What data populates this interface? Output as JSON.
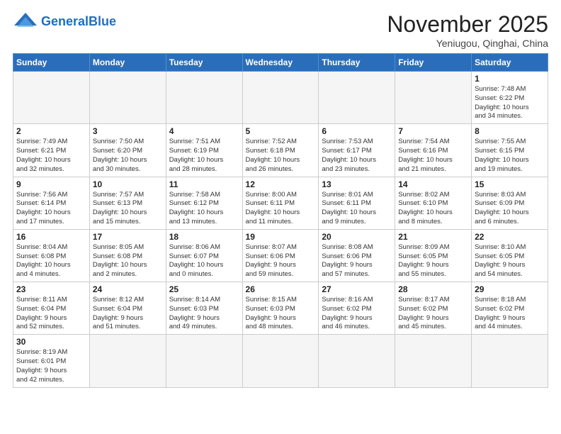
{
  "header": {
    "logo_general": "General",
    "logo_blue": "Blue",
    "month_title": "November 2025",
    "location": "Yeniugou, Qinghai, China"
  },
  "weekdays": [
    "Sunday",
    "Monday",
    "Tuesday",
    "Wednesday",
    "Thursday",
    "Friday",
    "Saturday"
  ],
  "weeks": [
    [
      {
        "day": "",
        "info": ""
      },
      {
        "day": "",
        "info": ""
      },
      {
        "day": "",
        "info": ""
      },
      {
        "day": "",
        "info": ""
      },
      {
        "day": "",
        "info": ""
      },
      {
        "day": "",
        "info": ""
      },
      {
        "day": "1",
        "info": "Sunrise: 7:48 AM\nSunset: 6:22 PM\nDaylight: 10 hours\nand 34 minutes."
      }
    ],
    [
      {
        "day": "2",
        "info": "Sunrise: 7:49 AM\nSunset: 6:21 PM\nDaylight: 10 hours\nand 32 minutes."
      },
      {
        "day": "3",
        "info": "Sunrise: 7:50 AM\nSunset: 6:20 PM\nDaylight: 10 hours\nand 30 minutes."
      },
      {
        "day": "4",
        "info": "Sunrise: 7:51 AM\nSunset: 6:19 PM\nDaylight: 10 hours\nand 28 minutes."
      },
      {
        "day": "5",
        "info": "Sunrise: 7:52 AM\nSunset: 6:18 PM\nDaylight: 10 hours\nand 26 minutes."
      },
      {
        "day": "6",
        "info": "Sunrise: 7:53 AM\nSunset: 6:17 PM\nDaylight: 10 hours\nand 23 minutes."
      },
      {
        "day": "7",
        "info": "Sunrise: 7:54 AM\nSunset: 6:16 PM\nDaylight: 10 hours\nand 21 minutes."
      },
      {
        "day": "8",
        "info": "Sunrise: 7:55 AM\nSunset: 6:15 PM\nDaylight: 10 hours\nand 19 minutes."
      }
    ],
    [
      {
        "day": "9",
        "info": "Sunrise: 7:56 AM\nSunset: 6:14 PM\nDaylight: 10 hours\nand 17 minutes."
      },
      {
        "day": "10",
        "info": "Sunrise: 7:57 AM\nSunset: 6:13 PM\nDaylight: 10 hours\nand 15 minutes."
      },
      {
        "day": "11",
        "info": "Sunrise: 7:58 AM\nSunset: 6:12 PM\nDaylight: 10 hours\nand 13 minutes."
      },
      {
        "day": "12",
        "info": "Sunrise: 8:00 AM\nSunset: 6:11 PM\nDaylight: 10 hours\nand 11 minutes."
      },
      {
        "day": "13",
        "info": "Sunrise: 8:01 AM\nSunset: 6:11 PM\nDaylight: 10 hours\nand 9 minutes."
      },
      {
        "day": "14",
        "info": "Sunrise: 8:02 AM\nSunset: 6:10 PM\nDaylight: 10 hours\nand 8 minutes."
      },
      {
        "day": "15",
        "info": "Sunrise: 8:03 AM\nSunset: 6:09 PM\nDaylight: 10 hours\nand 6 minutes."
      }
    ],
    [
      {
        "day": "16",
        "info": "Sunrise: 8:04 AM\nSunset: 6:08 PM\nDaylight: 10 hours\nand 4 minutes."
      },
      {
        "day": "17",
        "info": "Sunrise: 8:05 AM\nSunset: 6:08 PM\nDaylight: 10 hours\nand 2 minutes."
      },
      {
        "day": "18",
        "info": "Sunrise: 8:06 AM\nSunset: 6:07 PM\nDaylight: 10 hours\nand 0 minutes."
      },
      {
        "day": "19",
        "info": "Sunrise: 8:07 AM\nSunset: 6:06 PM\nDaylight: 9 hours\nand 59 minutes."
      },
      {
        "day": "20",
        "info": "Sunrise: 8:08 AM\nSunset: 6:06 PM\nDaylight: 9 hours\nand 57 minutes."
      },
      {
        "day": "21",
        "info": "Sunrise: 8:09 AM\nSunset: 6:05 PM\nDaylight: 9 hours\nand 55 minutes."
      },
      {
        "day": "22",
        "info": "Sunrise: 8:10 AM\nSunset: 6:05 PM\nDaylight: 9 hours\nand 54 minutes."
      }
    ],
    [
      {
        "day": "23",
        "info": "Sunrise: 8:11 AM\nSunset: 6:04 PM\nDaylight: 9 hours\nand 52 minutes."
      },
      {
        "day": "24",
        "info": "Sunrise: 8:12 AM\nSunset: 6:04 PM\nDaylight: 9 hours\nand 51 minutes."
      },
      {
        "day": "25",
        "info": "Sunrise: 8:14 AM\nSunset: 6:03 PM\nDaylight: 9 hours\nand 49 minutes."
      },
      {
        "day": "26",
        "info": "Sunrise: 8:15 AM\nSunset: 6:03 PM\nDaylight: 9 hours\nand 48 minutes."
      },
      {
        "day": "27",
        "info": "Sunrise: 8:16 AM\nSunset: 6:02 PM\nDaylight: 9 hours\nand 46 minutes."
      },
      {
        "day": "28",
        "info": "Sunrise: 8:17 AM\nSunset: 6:02 PM\nDaylight: 9 hours\nand 45 minutes."
      },
      {
        "day": "29",
        "info": "Sunrise: 8:18 AM\nSunset: 6:02 PM\nDaylight: 9 hours\nand 44 minutes."
      }
    ],
    [
      {
        "day": "30",
        "info": "Sunrise: 8:19 AM\nSunset: 6:01 PM\nDaylight: 9 hours\nand 42 minutes."
      },
      {
        "day": "",
        "info": ""
      },
      {
        "day": "",
        "info": ""
      },
      {
        "day": "",
        "info": ""
      },
      {
        "day": "",
        "info": ""
      },
      {
        "day": "",
        "info": ""
      },
      {
        "day": "",
        "info": ""
      }
    ]
  ]
}
